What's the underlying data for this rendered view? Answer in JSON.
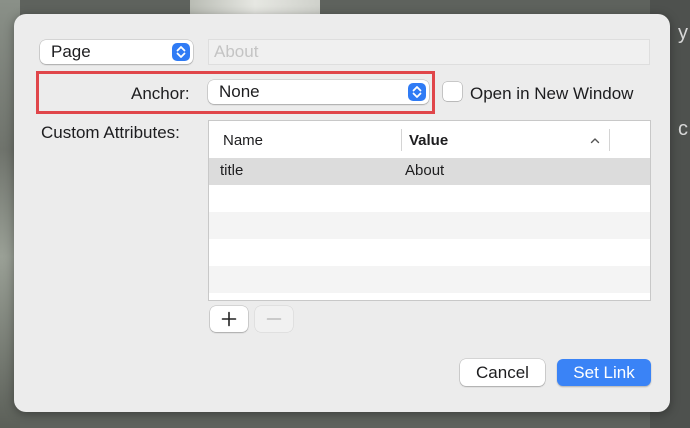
{
  "background": {
    "glyphs": [
      "y",
      "c"
    ]
  },
  "link_type": {
    "selected": "Page",
    "icon": "up-down-chevron-icon"
  },
  "url_field": {
    "value": "About"
  },
  "anchor": {
    "label": "Anchor:",
    "selected": "None"
  },
  "open_new_window": {
    "label": "Open in New Window",
    "checked": false
  },
  "custom_attributes": {
    "label": "Custom Attributes:",
    "columns": [
      "Name",
      "Value"
    ],
    "sorted_column": "Value",
    "sort_direction": "ascending",
    "rows": [
      {
        "name": "title",
        "value": "About"
      }
    ]
  },
  "table_buttons": {
    "add_icon": "plus-icon",
    "remove_icon": "minus-icon"
  },
  "actions": {
    "cancel": "Cancel",
    "set_link": "Set Link"
  },
  "colors": {
    "accent": "#3a83f6",
    "highlight": "#e0464a"
  }
}
